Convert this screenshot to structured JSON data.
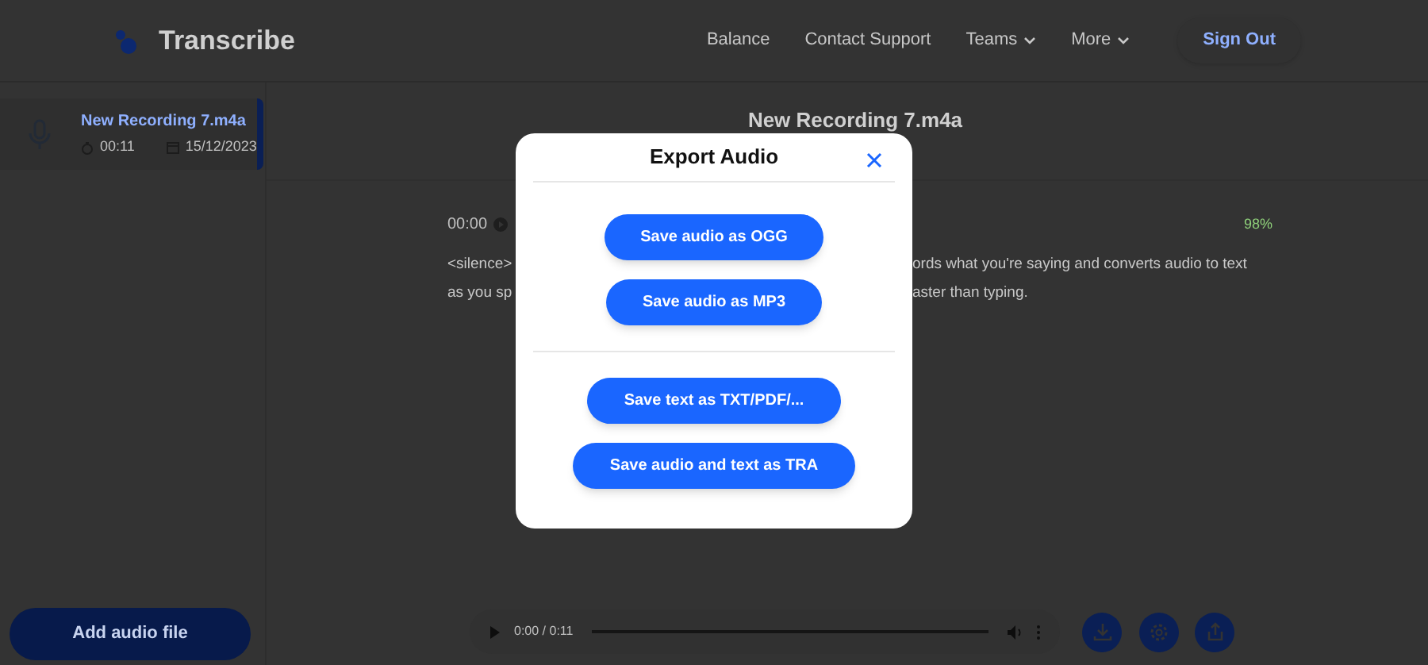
{
  "header": {
    "brand": "Transcribe",
    "nav": [
      {
        "label": "Balance",
        "dropdown": false
      },
      {
        "label": "Contact Support",
        "dropdown": false
      },
      {
        "label": "Teams",
        "dropdown": true
      },
      {
        "label": "More",
        "dropdown": true
      }
    ],
    "sign_out": "Sign Out"
  },
  "sidebar": {
    "recordings": [
      {
        "name": "New Recording 7.m4a",
        "duration": "00:11",
        "date": "15/12/2023",
        "selected": true
      }
    ],
    "add_button": "Add audio file"
  },
  "main": {
    "title": "New Recording 7.m4a",
    "time": "00:00",
    "confidence": "98%",
    "transcript_lines": [
      {
        "left": "<silence>",
        "right": "ords what you're saying and converts audio to text"
      },
      {
        "left": "as you sp",
        "right": "aster than typing."
      }
    ],
    "player": {
      "time": "0:00 / 0:11"
    }
  },
  "modal": {
    "title": "Export Audio",
    "groups": [
      [
        "Save audio as OGG",
        "Save audio as MP3"
      ],
      [
        "Save text as TXT/PDF/...",
        "Save audio and text as TRA"
      ]
    ]
  }
}
